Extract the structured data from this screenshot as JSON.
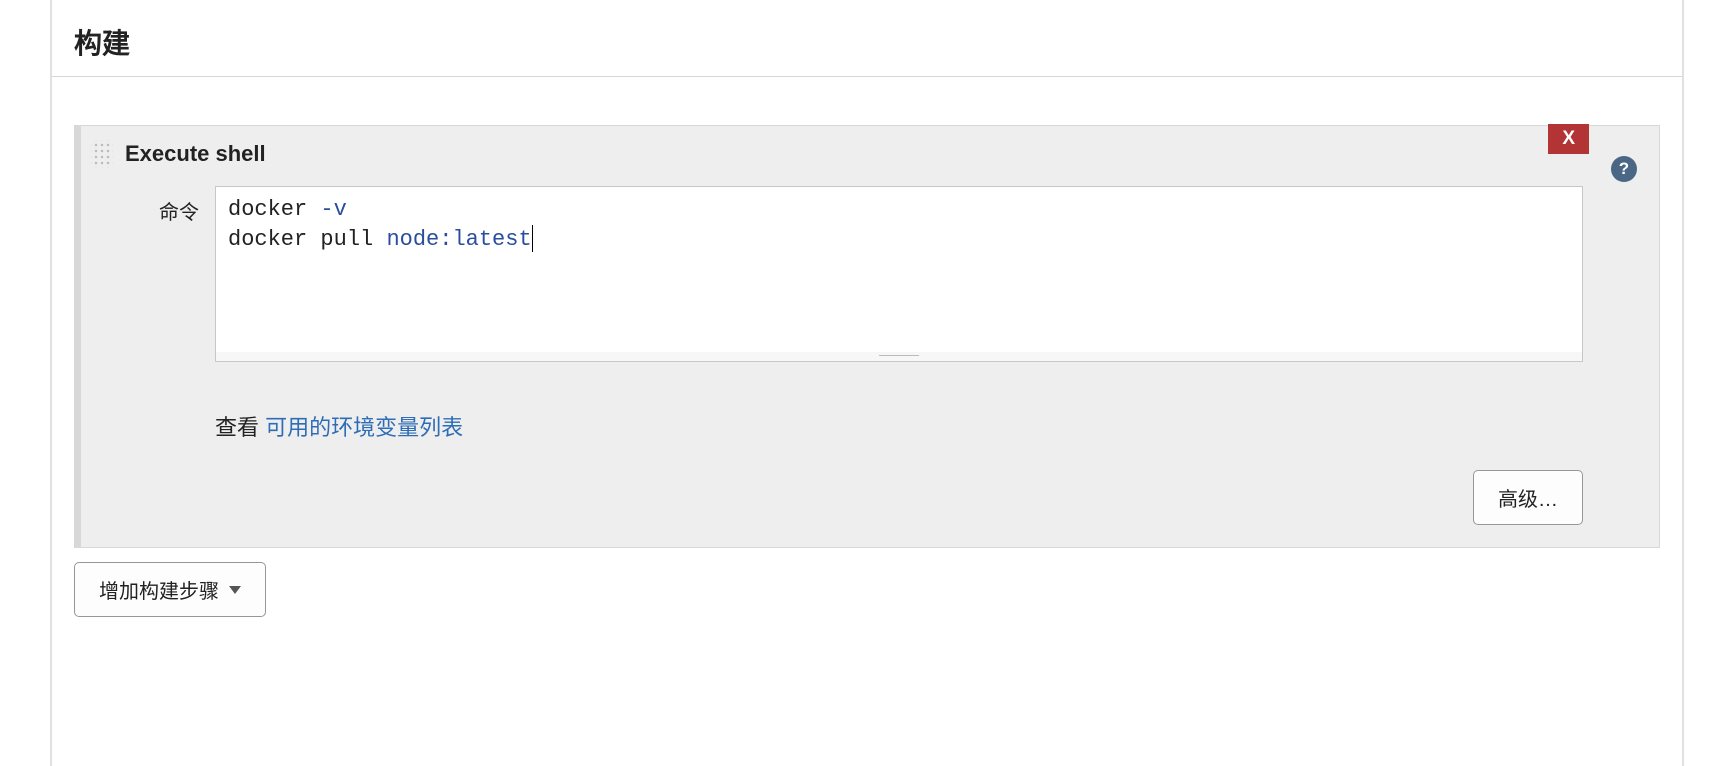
{
  "section": {
    "title": "构建"
  },
  "buildStep": {
    "title": "Execute shell",
    "closeLabel": "X",
    "helpSymbol": "?",
    "commandLabel": "命令",
    "code": {
      "line1_cmd": "docker",
      "line1_flag": "-v",
      "line2_cmd": "docker pull",
      "line2_arg": "node:latest"
    },
    "helpTextPrefix": "查看 ",
    "helpTextLink": "可用的环境变量列表",
    "advancedLabel": "高级…"
  },
  "addStepButton": {
    "label": "增加构建步骤"
  }
}
